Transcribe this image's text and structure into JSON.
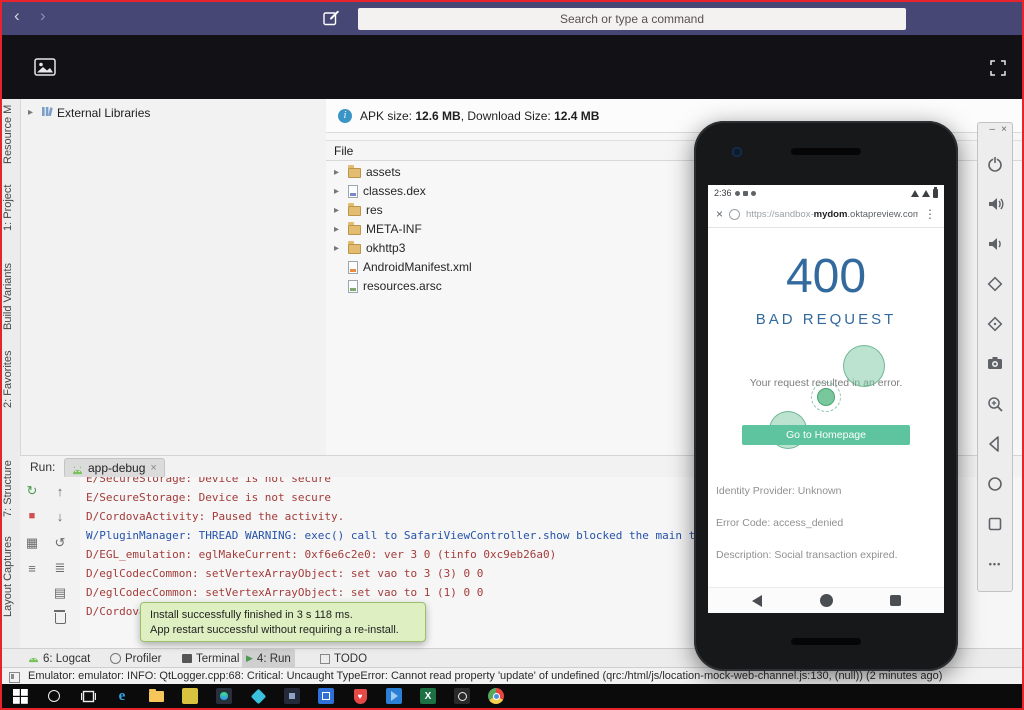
{
  "teams": {
    "search_placeholder": "Search or type a command"
  },
  "icons": {
    "back": "‹",
    "forward": "›",
    "expander": "▸",
    "rerun": "↻",
    "stop": "■",
    "grid": "▦",
    "restore": "≡",
    "up": "↑",
    "down": "↓",
    "history": "↺",
    "softwrap": "≣",
    "print": "▤",
    "close": "×",
    "menu": "⋮",
    "minimize": "–",
    "play": "▶",
    "ellipsis": "•••",
    "info": "i",
    "edge_e": "e",
    "excel_x": "X",
    "heart": "♥"
  },
  "ide": {
    "tool_strip": [
      "Resource M",
      "1: Project",
      "Build Variants",
      "2: Favorites",
      "7: Structure",
      "Layout Captures"
    ],
    "project": {
      "external_libraries": "External Libraries"
    },
    "apk": {
      "info_label_1": "APK size: ",
      "apk_size": "12.6 MB",
      "info_label_2": ", Download Size: ",
      "download_size": "12.4 MB",
      "column_header": "File",
      "tree": [
        {
          "name": "assets"
        },
        {
          "name": "classes.dex"
        },
        {
          "name": "res"
        },
        {
          "name": "META-INF"
        },
        {
          "name": "okhttp3"
        },
        {
          "name": "AndroidManifest.xml"
        },
        {
          "name": "resources.arsc"
        }
      ]
    },
    "run": {
      "label": "Run:",
      "tab": "app-debug",
      "console": [
        "E/SecureStorage: Device is not secure",
        "E/SecureStorage: Device is not secure",
        "D/CordovaActivity: Paused the activity.",
        "W/PluginManager: THREAD WARNING: exec() call to SafariViewController.show blocked the main thr",
        "D/EGL_emulation: eglMakeCurrent: 0xf6e6c2e0: ver 3 0 (tinfo 0xc9eb26a0)",
        "D/eglCodecCommon: setVertexArrayObject: set vao to 3 (3) 0 0",
        "D/eglCodecCommon: setVertexArrayObject: set vao to 1 (1) 0 0",
        "D/CordovaActivity:"
      ],
      "tooltip_line1": "Install successfully finished in 3 s 118 ms.",
      "tooltip_line2": "App restart successful without requiring a re-install."
    },
    "tabs": [
      "6: Logcat",
      "Profiler",
      "Terminal",
      "4: Run",
      "TODO"
    ],
    "status": "Emulator: emulator: INFO: QtLogger.cpp:68: Critical: Uncaught TypeError: Cannot read property 'update' of undefined (qrc:/html/js/location-mock-web-channel.js:130, (null)) (2 minutes ago)"
  },
  "emulator": {
    "time": "2:36",
    "url_prefix": "https://sandbox-",
    "url_host": "mydom",
    "url_suffix": ".oktapreview.com",
    "page": {
      "code": "400",
      "title": "BAD REQUEST",
      "message": "Your request resulted in an error.",
      "button": "Go to Homepage",
      "details": [
        "Identity Provider: Unknown",
        "Error Code: access_denied",
        "Description: Social transaction expired."
      ]
    }
  },
  "taskbar": {
    "apps": [
      "start",
      "search",
      "task-view",
      "edge",
      "file-explorer",
      "notes",
      "android-studio",
      "gem",
      "dark-app",
      "blue-window",
      "security-shield",
      "vscode",
      "excel",
      "camera",
      "chrome"
    ]
  },
  "colors": {
    "teams_purple": "#464775",
    "okta_blue": "#336a9e",
    "button_green": "#5ec4a0",
    "console_error": "#a33c3a",
    "console_warning": "#2553a8",
    "tooltip_green": "#def0c2",
    "border_red": "#e9232e"
  }
}
